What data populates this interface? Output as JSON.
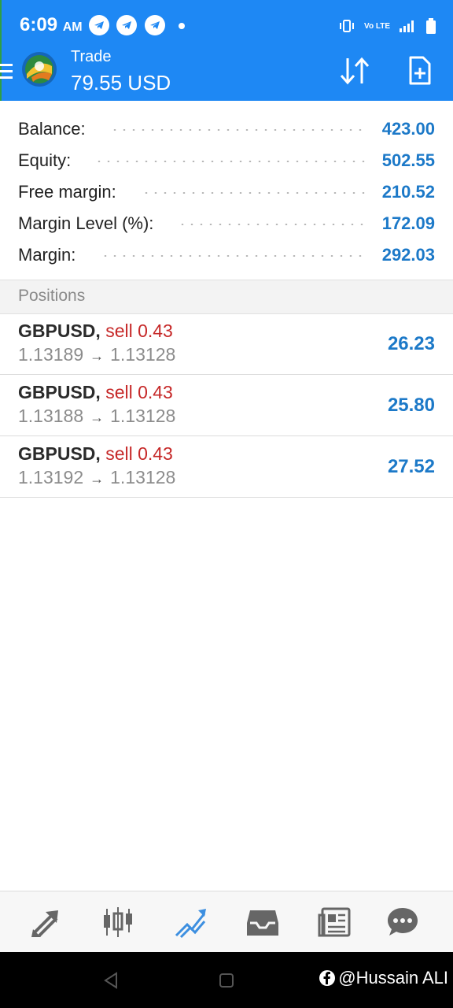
{
  "status_bar": {
    "time": "6:09",
    "ampm": "AM",
    "network": "Vo LTE"
  },
  "header": {
    "title": "Trade",
    "amount": "79.55 USD"
  },
  "summary": [
    {
      "label": "Balance:",
      "value": "423.00"
    },
    {
      "label": "Equity:",
      "value": "502.55"
    },
    {
      "label": "Free margin:",
      "value": "210.52"
    },
    {
      "label": "Margin Level (%):",
      "value": "172.09"
    },
    {
      "label": "Margin:",
      "value": "292.03"
    }
  ],
  "positions": {
    "heading": "Positions",
    "items": [
      {
        "symbol": "GBPUSD,",
        "side": "sell 0.43",
        "open": "1.13189",
        "arrow": "→",
        "current": "1.13128",
        "profit": "26.23"
      },
      {
        "symbol": "GBPUSD,",
        "side": "sell 0.43",
        "open": "1.13188",
        "arrow": "→",
        "current": "1.13128",
        "profit": "25.80"
      },
      {
        "symbol": "GBPUSD,",
        "side": "sell 0.43",
        "open": "1.13192",
        "arrow": "→",
        "current": "1.13128",
        "profit": "27.52"
      }
    ]
  },
  "bottom_nav": [
    "quotes-icon",
    "chart-icon",
    "trade-icon",
    "history-icon",
    "news-icon",
    "messages-icon"
  ],
  "watermark": "@Hussain ALI",
  "colors": {
    "header_bg": "#1e88f4",
    "value_blue": "#1c79c8",
    "sell_red": "#c62828",
    "active_nav": "#3d8fe0"
  }
}
